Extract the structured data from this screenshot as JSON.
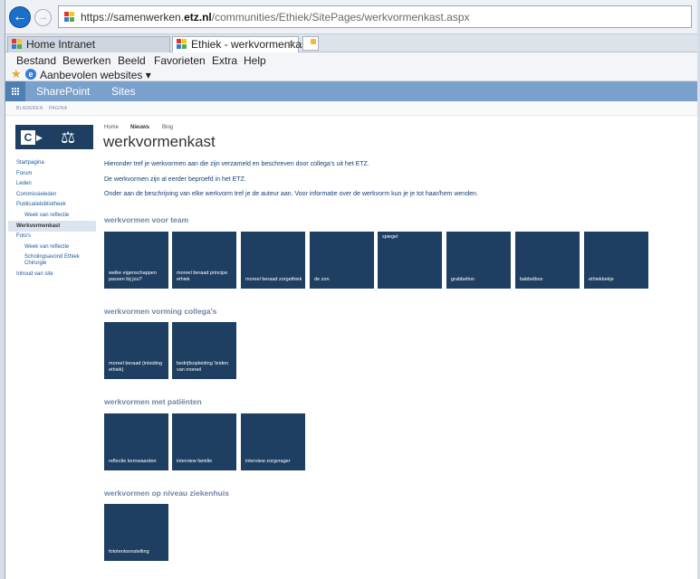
{
  "browser": {
    "url_scheme": "https://",
    "url_host_pre": "samenwerken.",
    "url_host_domain": "etz.nl",
    "url_path": "/communities/Ethiek/SitePages/werkvormenkast.aspx",
    "tabs": [
      {
        "label": "Home Intranet"
      },
      {
        "label": "Ethiek - werkvormenkast"
      }
    ],
    "tab_close": "×",
    "menu": [
      "Bestand",
      "Bewerken",
      "Beeld",
      "Favorieten",
      "Extra",
      "Help"
    ],
    "favorites_link": "Aanbevolen websites ▾"
  },
  "suitebar": {
    "brand": "SharePoint",
    "sites": "Sites"
  },
  "ribbon": {
    "tabs": [
      "BLADEREN",
      "PAGINA"
    ]
  },
  "breadcrumb": [
    "Home",
    "Nieuws",
    "Blog"
  ],
  "page_title": "werkvormenkast",
  "leftnav": [
    {
      "label": "Startpagina"
    },
    {
      "label": "Forum"
    },
    {
      "label": "Leden"
    },
    {
      "label": "Commissieleden"
    },
    {
      "label": "Publicatiebibliotheek"
    },
    {
      "label": "Week van reflectie"
    },
    {
      "label": "Werkvormenkast"
    },
    {
      "label": "Foto's"
    },
    {
      "label": "Week van reflectie"
    },
    {
      "label": "Scholingsavond Ethiek"
    },
    {
      "label": "Chirurgie"
    },
    {
      "label": "Inhoud van site"
    }
  ],
  "intro": [
    "Hieronder tref je werkvormen aan die zijn verzameld en beschreven door collega's uit het ETZ.",
    "De werkvormen zijn al eerder beproefd in het ETZ.",
    "Onder aan de beschrijving van elke werkvorm tref je de auteur aan. Voor informatie over de werkvorm kun je je tot haar/hem wenden."
  ],
  "sections": [
    {
      "heading": "werkvormen voor team",
      "tiles": [
        {
          "label": "welke eigenschappen passen bij jou?"
        },
        {
          "label": "moreel beraad principe ethiek"
        },
        {
          "label": "moreel beraad zorgethiek"
        },
        {
          "label": "de zon"
        },
        {
          "label": "spiegel"
        },
        {
          "label": "grabbelton"
        },
        {
          "label": "babbelbox"
        },
        {
          "label": "ethiekbekje"
        }
      ]
    },
    {
      "heading": "werkvormen vorming collega's",
      "tiles": [
        {
          "label": "moreel beraad (inleiding ethiek)"
        },
        {
          "label": "bedrijfsopleiding 'leiden van moreel"
        }
      ]
    },
    {
      "heading": "werkvormen met patiënten",
      "tiles": [
        {
          "label": "reflectie kernwaarden"
        },
        {
          "label": "interview familie"
        },
        {
          "label": "interview zorgvrager"
        }
      ]
    },
    {
      "heading": "werkvormen op niveau ziekenhuis",
      "tiles": [
        {
          "label": "fototentoonstelling"
        }
      ]
    }
  ],
  "colors": {
    "tile_bg": "#1e3f62",
    "suitebar_bg": "#7aa0cc",
    "link": "#1a5a9e",
    "intro_text": "#123f78"
  }
}
